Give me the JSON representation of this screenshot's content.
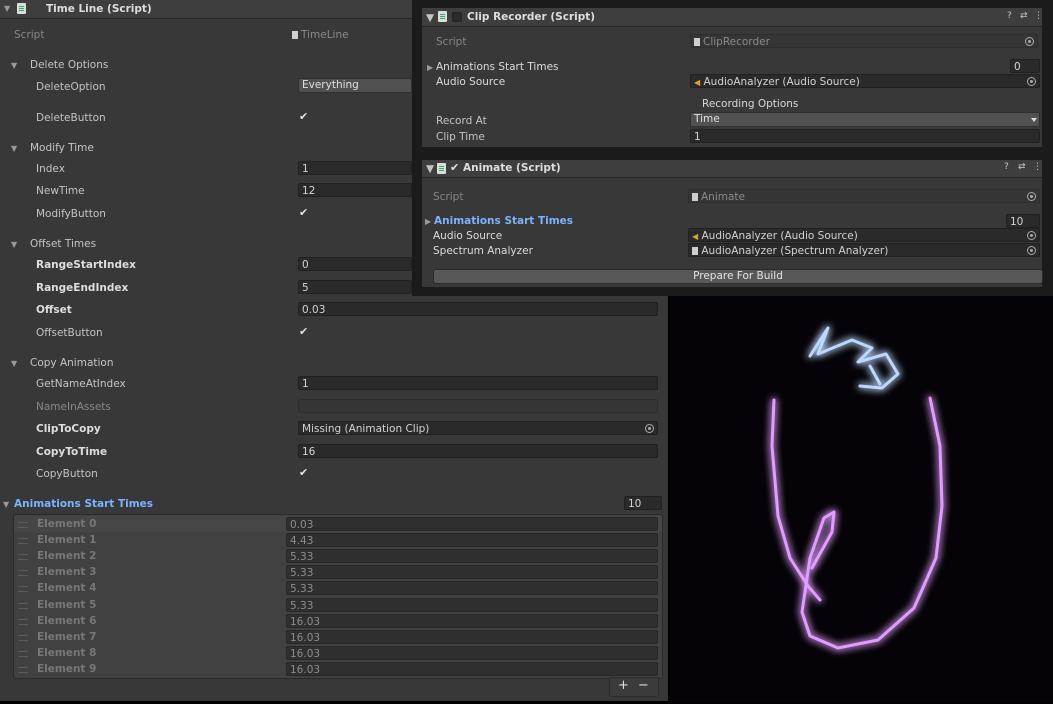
{
  "timeline": {
    "title": "Time Line (Script)",
    "script_label": "Script",
    "script_value": "TimeLine",
    "delete_options": {
      "header": "Delete Options",
      "option_label": "DeleteOption",
      "option_value": "Everything",
      "button_label": "DeleteButton",
      "button_checked": "✔"
    },
    "modify_time": {
      "header": "Modify Time",
      "index_label": "Index",
      "index_value": "1",
      "newtime_label": "NewTime",
      "newtime_value": "12",
      "button_label": "ModifyButton",
      "button_checked": "✔"
    },
    "offset_times": {
      "header": "Offset Times",
      "range_start_label": "RangeStartIndex",
      "range_start_value": "0",
      "range_end_label": "RangeEndIndex",
      "range_end_value": "5",
      "offset_label": "Offset",
      "offset_value": "0.03",
      "button_label": "OffsetButton",
      "button_checked": "✔"
    },
    "copy_animation": {
      "header": "Copy Animation",
      "get_name_label": "GetNameAtIndex",
      "get_name_value": "1",
      "name_in_assets_label": "NameInAssets",
      "name_in_assets_value": "",
      "clip_to_copy_label": "ClipToCopy",
      "clip_to_copy_value": "Missing (Animation Clip)",
      "copy_to_time_label": "CopyToTime",
      "copy_to_time_value": "16",
      "button_label": "CopyButton",
      "button_checked": "✔"
    },
    "anim_list": {
      "header": "Animations Start Times",
      "size": "10",
      "elements": [
        {
          "label": "Element 0",
          "value": "0.03"
        },
        {
          "label": "Element 1",
          "value": "4.43"
        },
        {
          "label": "Element 2",
          "value": "5.33"
        },
        {
          "label": "Element 3",
          "value": "5.33"
        },
        {
          "label": "Element 4",
          "value": "5.33"
        },
        {
          "label": "Element 5",
          "value": "5.33"
        },
        {
          "label": "Element 6",
          "value": "16.03"
        },
        {
          "label": "Element 7",
          "value": "16.03"
        },
        {
          "label": "Element 8",
          "value": "16.03"
        },
        {
          "label": "Element 9",
          "value": "16.03"
        }
      ],
      "plus": "+",
      "minus": "−"
    }
  },
  "clip_recorder": {
    "title": "Clip Recorder (Script)",
    "script_label": "Script",
    "script_value": "ClipRecorder",
    "anim_start_label": "Animations Start Times",
    "anim_start_value": "0",
    "audio_source_label": "Audio Source",
    "audio_source_value": "AudioAnalyzer (Audio Source)",
    "recording_options": "Recording Options",
    "record_at_label": "Record At",
    "record_at_value": "Time",
    "clip_time_label": "Clip Time",
    "clip_time_value": "1"
  },
  "animate": {
    "title": "Animate (Script)",
    "checkmark": "✔",
    "script_label": "Script",
    "script_value": "Animate",
    "anim_start_label": "Animations Start Times",
    "anim_start_value": "10",
    "audio_source_label": "Audio Source",
    "audio_source_value": "AudioAnalyzer (Audio Source)",
    "spectrum_label": "Spectrum Analyzer",
    "spectrum_value": "AudioAnalyzer (Spectrum Analyzer)",
    "build_button": "Prepare For Build"
  },
  "header_icons": {
    "help": "?",
    "settings": "⇄",
    "more": "⋮"
  },
  "colors": {
    "accent_blue": "#7cb3ff",
    "glow_purple": "#d77cff",
    "glow_blue": "#9fc8ff"
  }
}
